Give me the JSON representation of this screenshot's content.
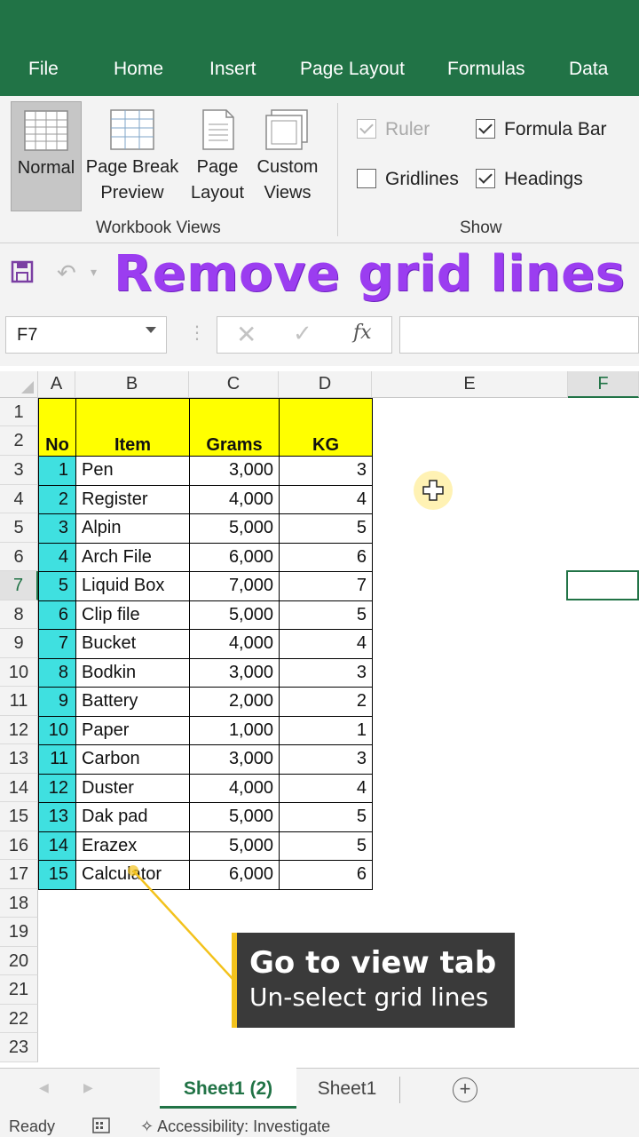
{
  "menu": {
    "items": [
      "File",
      "Home",
      "Insert",
      "Page Layout",
      "Formulas",
      "Data"
    ]
  },
  "ribbon": {
    "views": [
      {
        "line1": "Normal",
        "line2": ""
      },
      {
        "line1": "Page Break",
        "line2": "Preview"
      },
      {
        "line1": "Page",
        "line2": "Layout"
      },
      {
        "line1": "Custom",
        "line2": "Views"
      }
    ],
    "workbook_views_label": "Workbook Views",
    "show_label": "Show",
    "checks": {
      "ruler": "Ruler",
      "formula_bar": "Formula Bar",
      "gridlines": "Gridlines",
      "headings": "Headings"
    }
  },
  "overlay_title": "Remove grid lines",
  "formula_bar": {
    "name_box": "F7",
    "fx": "fx"
  },
  "grid": {
    "columns": [
      "A",
      "B",
      "C",
      "D",
      "E",
      "F"
    ],
    "rows": [
      "1",
      "2",
      "3",
      "4",
      "5",
      "6",
      "7",
      "8",
      "9",
      "10",
      "11",
      "12",
      "13",
      "14",
      "15",
      "16",
      "17",
      "18",
      "19",
      "20",
      "21",
      "22",
      "23"
    ],
    "table_header": {
      "no": "No",
      "item": "Item",
      "grams": "Grams",
      "kg": "KG"
    },
    "table_rows": [
      [
        "1",
        "Pen",
        "3,000",
        "3"
      ],
      [
        "2",
        "Register",
        "4,000",
        "4"
      ],
      [
        "3",
        "Alpin",
        "5,000",
        "5"
      ],
      [
        "4",
        "Arch File",
        "6,000",
        "6"
      ],
      [
        "5",
        "Liquid Box",
        "7,000",
        "7"
      ],
      [
        "6",
        "Clip file",
        "5,000",
        "5"
      ],
      [
        "7",
        "Bucket",
        "4,000",
        "4"
      ],
      [
        "8",
        "Bodkin",
        "3,000",
        "3"
      ],
      [
        "9",
        "Battery",
        "2,000",
        "2"
      ],
      [
        "10",
        "Paper",
        "1,000",
        "1"
      ],
      [
        "11",
        "Carbon",
        "3,000",
        "3"
      ],
      [
        "12",
        "Duster",
        "4,000",
        "4"
      ],
      [
        "13",
        "Dak pad",
        "5,000",
        "5"
      ],
      [
        "14",
        "Erazex",
        "5,000",
        "5"
      ],
      [
        "15",
        "Calculator",
        "6,000",
        "6"
      ]
    ]
  },
  "callout": {
    "title": "Go to view tab",
    "subtitle": "Un-select grid lines"
  },
  "sheets": {
    "active": "Sheet1 (2)",
    "other": "Sheet1",
    "add": "+"
  },
  "status": {
    "ready": "Ready",
    "accessibility": "Accessibility: Investigate"
  },
  "colors": {
    "excel_green": "#217346",
    "header_yellow": "#ffff00",
    "no_cyan": "#3fe0e0",
    "title_purple": "#9b3df0",
    "callout_accent": "#f3c21c"
  }
}
